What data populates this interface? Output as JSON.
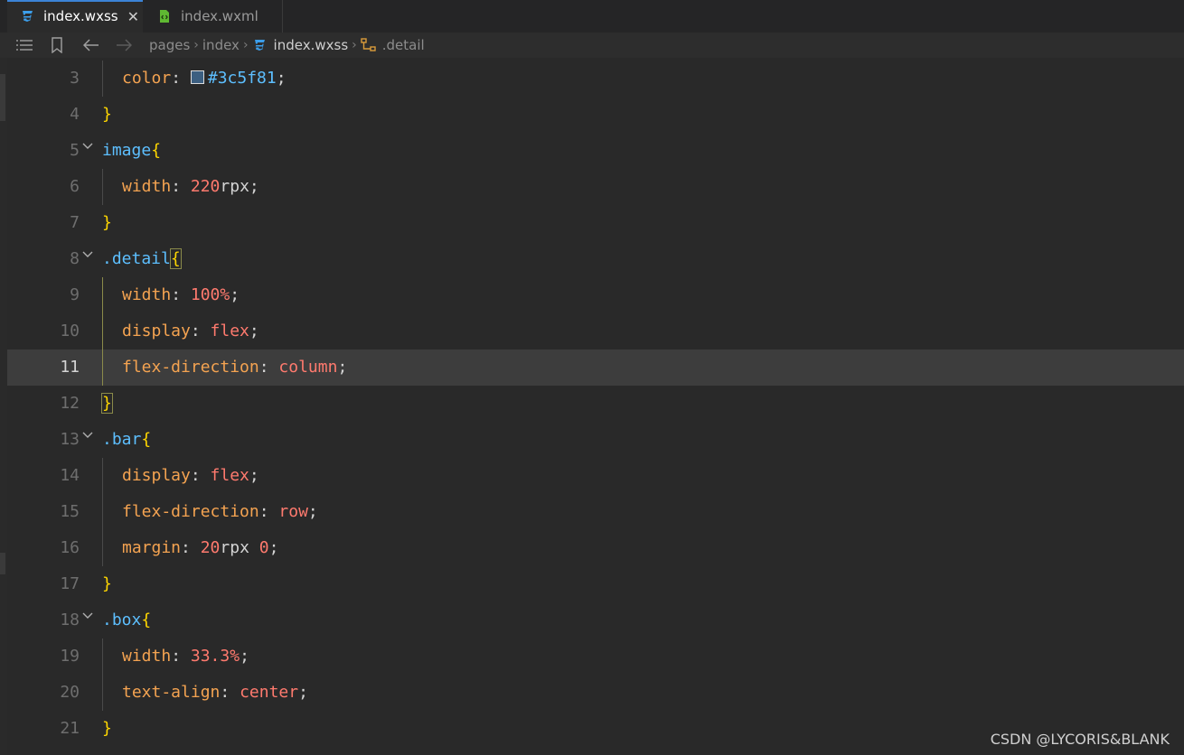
{
  "tabs": [
    {
      "label": "index.wxss",
      "icon": "css-file-icon",
      "active": true
    },
    {
      "label": "index.wxml",
      "icon": "wxml-file-icon",
      "active": false
    }
  ],
  "breadcrumb": {
    "items": [
      "pages",
      "index",
      "index.wxss",
      ".detail"
    ]
  },
  "lines": [
    {
      "num": "3"
    },
    {
      "num": "4"
    },
    {
      "num": "5"
    },
    {
      "num": "6"
    },
    {
      "num": "7"
    },
    {
      "num": "8"
    },
    {
      "num": "9"
    },
    {
      "num": "10"
    },
    {
      "num": "11"
    },
    {
      "num": "12"
    },
    {
      "num": "13"
    },
    {
      "num": "14"
    },
    {
      "num": "15"
    },
    {
      "num": "16"
    },
    {
      "num": "17"
    },
    {
      "num": "18"
    },
    {
      "num": "19"
    },
    {
      "num": "20"
    },
    {
      "num": "21"
    }
  ],
  "code": {
    "l3": {
      "prop": "color",
      "value": "#3c5f81"
    },
    "l5": {
      "sel": "image"
    },
    "l6": {
      "prop": "width",
      "num": "220",
      "unit": "rpx"
    },
    "l8": {
      "sel": ".detail"
    },
    "l9": {
      "prop": "width",
      "num": "100%"
    },
    "l10": {
      "prop": "display",
      "val": "flex"
    },
    "l11": {
      "prop": "flex-direction",
      "val": "column"
    },
    "l13": {
      "sel": ".bar"
    },
    "l14": {
      "prop": "display",
      "val": "flex"
    },
    "l15": {
      "prop": "flex-direction",
      "val": "row"
    },
    "l16": {
      "prop": "margin",
      "num": "20",
      "unit": "rpx",
      "num2": "0"
    },
    "l18": {
      "sel": ".box"
    },
    "l19": {
      "prop": "width",
      "num": "33.3%"
    },
    "l20": {
      "prop": "text-align",
      "val": "center"
    },
    "brace_open": "{",
    "brace_close": "}",
    "colon": ":",
    "semi": ";"
  },
  "active_line": "11",
  "color_swatch": "#3c5f81",
  "watermark": "CSDN @LYCORIS&BLANK"
}
